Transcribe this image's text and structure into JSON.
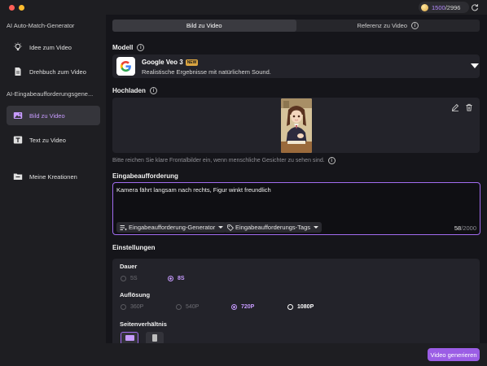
{
  "credits": {
    "used": "1500",
    "total": "/2996"
  },
  "sidebar": {
    "section1": "AI Auto-Match-Generator",
    "items1": [
      {
        "label": "Idee zum Video",
        "icon": "lightbulb-icon"
      },
      {
        "label": "Drehbuch zum Video",
        "icon": "document-icon"
      }
    ],
    "section2": "AI-Eingabeaufforderungsgene...",
    "items2": [
      {
        "label": "Bild zu Video",
        "icon": "image-icon",
        "active": true
      },
      {
        "label": "Text zu Video",
        "icon": "text-icon"
      }
    ],
    "items3": [
      {
        "label": "Meine Kreationen",
        "icon": "folder-icon"
      }
    ]
  },
  "tabs": [
    {
      "label": "Bild zu Video",
      "active": true
    },
    {
      "label": "Referenz zu Video",
      "active": false
    }
  ],
  "model": {
    "section_label": "Modell",
    "name": "Google Veo 3",
    "badge": "NEW",
    "description": "Realistische Ergebnisse mit natürlichem Sound."
  },
  "upload": {
    "section_label": "Hochladen",
    "hint": "Bitte reichen Sie klare Frontalbilder ein, wenn menschliche Gesichter zu sehen sind."
  },
  "prompt": {
    "section_label": "Eingabeaufforderung",
    "text": "Kamera fährt langsam nach rechts, Figur winkt freundlich",
    "generator_button": "Eingabeaufforderung-Generator",
    "tags_button": "Eingabeaufforderungs-Tags",
    "count": "58",
    "max": "/2000"
  },
  "settings": {
    "section_label": "Einstellungen",
    "duration_label": "Dauer",
    "duration_options": [
      {
        "label": "5S",
        "selected": false
      },
      {
        "label": "8S",
        "selected": true
      }
    ],
    "resolution_label": "Auflösung",
    "resolution_options": [
      {
        "label": "360P",
        "selected": false
      },
      {
        "label": "540P",
        "selected": false
      },
      {
        "label": "720P",
        "selected": true
      },
      {
        "label": "1080P",
        "selected": false
      }
    ],
    "ratio_label": "Seitenverhältnis"
  },
  "generate_button": "Video generieren",
  "colors": {
    "accent": "#9b5de5",
    "accent_light": "#c79bff"
  }
}
